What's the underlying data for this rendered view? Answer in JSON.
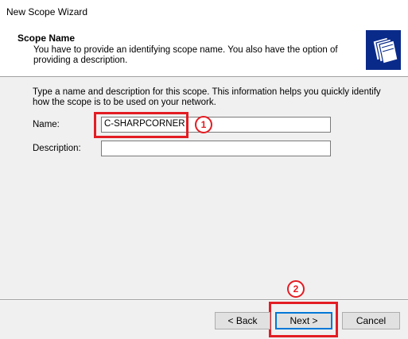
{
  "window": {
    "title": "New Scope Wizard"
  },
  "header": {
    "title": "Scope Name",
    "subtitle": "You have to provide an identifying scope name. You also have the option of providing a description."
  },
  "main": {
    "intro": "Type a name and description for this scope. This information helps you quickly identify how the scope is to be used on your network.",
    "name_label": "Name:",
    "name_value": "C-SHARPCORNER",
    "description_label": "Description:",
    "description_value": ""
  },
  "annotations": {
    "step1": "1",
    "step2": "2",
    "color": "#e31c23"
  },
  "buttons": {
    "back": "< Back",
    "next": "Next >",
    "cancel": "Cancel"
  },
  "icons": {
    "header_icon": "folders-icon"
  }
}
